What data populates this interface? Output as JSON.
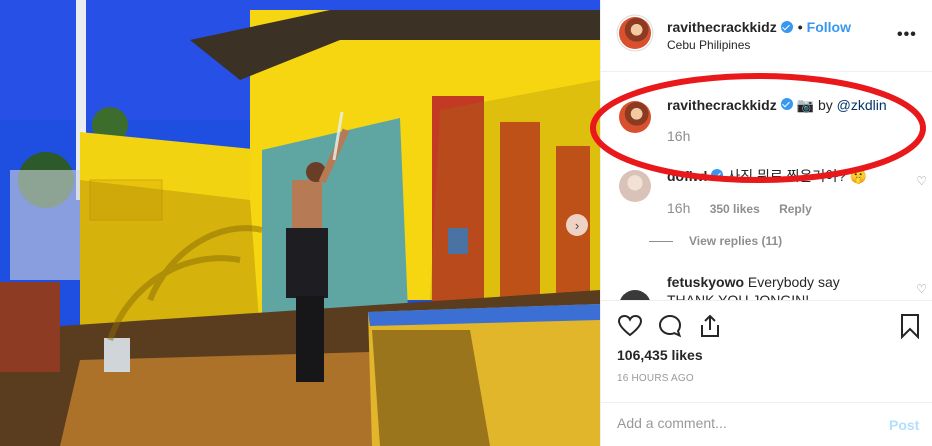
{
  "post": {
    "username": "ravithecrackkidz",
    "follow_label": "Follow",
    "location": "Cebu Philipines",
    "more_glyph": "•••"
  },
  "caption": {
    "username": "ravithecrackkidz",
    "camera_emoji": "📷",
    "by_text": "by",
    "mention": "@zkdlin",
    "time": "16h"
  },
  "comments": [
    {
      "username": "doflwl",
      "text": "사진 뭐로 찍은거야? 🤫",
      "time": "16h",
      "likes": "350 likes",
      "reply_label": "Reply",
      "view_replies": "View replies (11)"
    },
    {
      "username": "fetuskyowo",
      "text": "Everybody say",
      "overflow_text": "THANK YOU JONGIN!"
    }
  ],
  "actions": {
    "likes": "106,435 likes",
    "timestamp": "16 HOURS AGO"
  },
  "composer": {
    "placeholder": "Add a comment...",
    "post_label": "Post"
  },
  "colors": {
    "accent": "#3897f0",
    "annotation_red": "#e8181b"
  },
  "icons": {
    "like": "heart-outline-icon",
    "comment": "speech-bubble-icon",
    "share": "share-icon",
    "save": "bookmark-icon",
    "carousel": "chevron-right-icon",
    "verified": "verified-badge-icon"
  }
}
